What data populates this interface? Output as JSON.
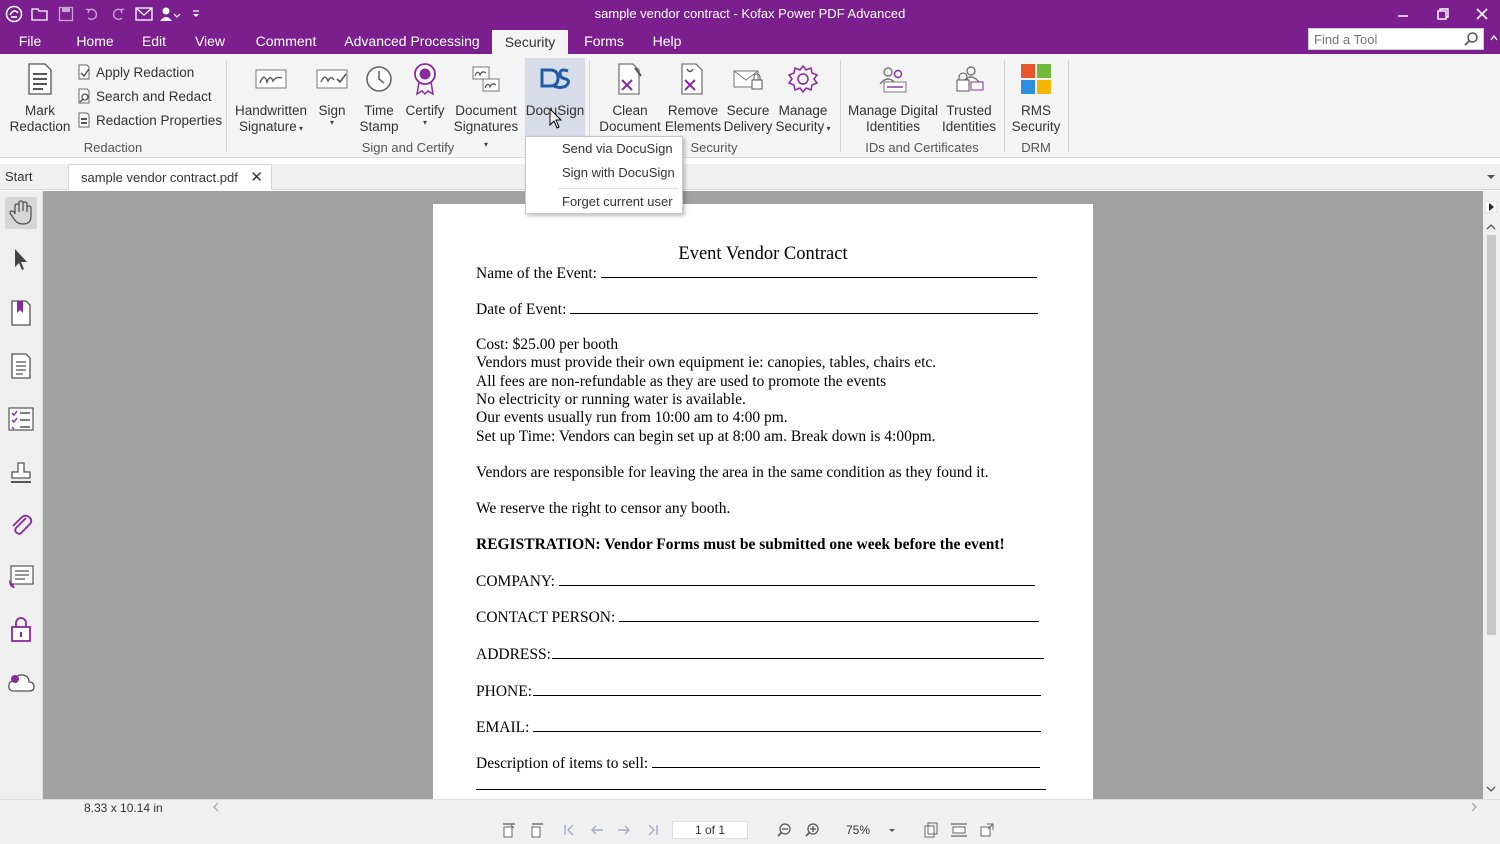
{
  "window": {
    "title": "sample vendor contract - Kofax Power PDF Advanced",
    "icons": [
      "app-logo-icon",
      "open-folder-icon",
      "save-icon",
      "undo-icon",
      "redo-icon",
      "email-icon",
      "user-sign-icon",
      "customize-qat-icon"
    ],
    "controls": [
      "minimize",
      "restore",
      "close"
    ]
  },
  "menu": {
    "tabs": [
      "File",
      "Home",
      "Edit",
      "View",
      "Comment",
      "Advanced Processing",
      "Security",
      "Forms",
      "Help"
    ],
    "active": "Security",
    "find_tool_placeholder": "Find a Tool"
  },
  "ribbon": {
    "redaction": {
      "mark_redaction": [
        "Mark",
        "Redaction"
      ],
      "apply_redaction": "Apply Redaction",
      "search_and_redact": "Search and Redact",
      "redaction_properties": "Redaction Properties",
      "group_label": "Redaction"
    },
    "sign_and_certify": {
      "handwritten_signature": [
        "Handwritten",
        "Signature"
      ],
      "sign": "Sign",
      "time_stamp": [
        "Time",
        "Stamp"
      ],
      "certify": "Certify",
      "document_signatures": [
        "Document",
        "Signatures"
      ],
      "docusign": "DocuSign",
      "group_label": "Sign and Certify"
    },
    "security": {
      "clean_document": [
        "Clean",
        "Document"
      ],
      "remove_elements": [
        "Remove",
        "Elements"
      ],
      "secure_delivery": [
        "Secure",
        "Delivery"
      ],
      "manage_security": [
        "Manage",
        "Security"
      ],
      "group_label": "Security"
    },
    "ids_and_certificates": {
      "manage_digital_identities": [
        "Manage Digital",
        "Identities"
      ],
      "trusted_identities": [
        "Trusted",
        "Identities"
      ],
      "group_label": "IDs and Certificates"
    },
    "drm": {
      "rms_security": [
        "RMS",
        "Security"
      ],
      "group_label": "DRM"
    }
  },
  "docusign_menu": {
    "items": [
      "Send via DocuSign",
      "Sign with DocuSign",
      "Forget current user"
    ]
  },
  "doc_tabs": {
    "start": "Start",
    "active_file": "sample vendor contract.pdf",
    "close_glyph": "✕"
  },
  "left_panel": {
    "icons": [
      "hand-tool-icon",
      "select-arrow-icon",
      "bookmarks-icon",
      "pages-icon",
      "tasks-icon",
      "stamp-icon",
      "attachments-icon",
      "comments-icon",
      "security-lock-icon",
      "cloud-icon"
    ]
  },
  "document": {
    "title": "Event Vendor Contract",
    "name_of_event": "Name of the Event:",
    "date_of_event": "Date of Event:",
    "cost": "Cost:  $25.00   per booth",
    "equipment": "Vendors must provide their own equipment ie:  canopies, tables, chairs etc.",
    "fees": "All fees are non-refundable as they are used to promote the events",
    "electricity": "No electricity or running water is available.",
    "hours": "Our events usually run from 10:00 am to 4:00 pm.",
    "setup": "Set up Time: Vendors can begin set up at 8:00 am.  Break down is 4:00pm.",
    "responsibility": "Vendors are responsible for leaving the area in the same condition as they found it.",
    "censor": "We reserve the right to censor any booth.",
    "registration": "REGISTRATION:    Vendor Forms must be submitted one week before the event!",
    "company": "COMPANY:",
    "contact_person": "CONTACT PERSON:",
    "address": "ADDRESS:",
    "phone": "PHONE:",
    "email": "EMAIL:",
    "description": "Description of items to sell:"
  },
  "status": {
    "page_size": "8.33 x 10.14 in",
    "page_indicator": "1 of 1",
    "zoom": "75%"
  },
  "colors": {
    "titlebar": "#7b1f8f",
    "ribbon": "#f4f4f4",
    "canvas": "#a1a1a1",
    "accent_icon": "#8a2a9c"
  }
}
